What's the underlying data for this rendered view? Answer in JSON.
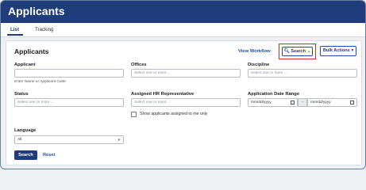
{
  "header": {
    "title": "Applicants"
  },
  "tabs": [
    {
      "label": "List",
      "active": true
    },
    {
      "label": "Tracking",
      "active": false
    }
  ],
  "card": {
    "title": "Applicants",
    "view_workflow": "View Workflow",
    "search_button": "Search",
    "bulk_actions_button": "Bulk Actions",
    "icons": {
      "search": "search-icon",
      "chevron": "chevron-down-icon",
      "caret": "caret-down-icon"
    }
  },
  "filters": {
    "applicant": {
      "label": "Applicant",
      "value": "",
      "hint": "Enter Name or Applicant Code"
    },
    "offices": {
      "label": "Offices",
      "placeholder": "Select one or more ..."
    },
    "discipline": {
      "label": "Discipline",
      "placeholder": "Select one or more ..."
    },
    "status": {
      "label": "Status",
      "placeholder": "Select one or more ..."
    },
    "assigned_hr": {
      "label": "Assigned HR Representative",
      "placeholder": "Select one or more ..."
    },
    "show_assigned": {
      "label": "Show applicants assigned to me only",
      "checked": false
    },
    "date_range": {
      "label": "Application Date Range",
      "from_placeholder": "mm/dd/yyyy",
      "separator": "-",
      "to_placeholder": "mm/dd/yyyy"
    },
    "language": {
      "label": "Language",
      "selected": "All"
    }
  },
  "actions": {
    "search": "Search",
    "reset": "Reset"
  },
  "colors": {
    "header": "#1f3d7a",
    "accent": "#1f4fa0",
    "highlight": "#d62a2a"
  }
}
